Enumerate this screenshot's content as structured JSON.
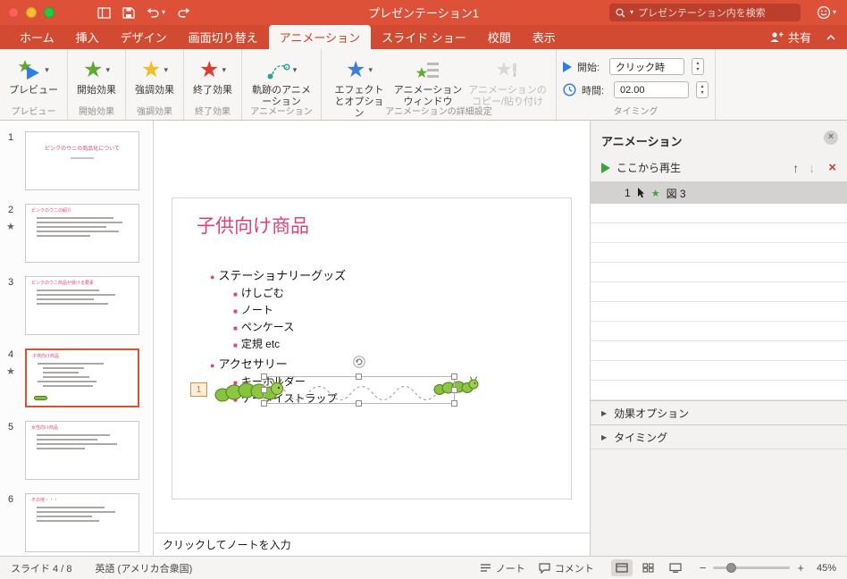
{
  "titlebar": {
    "title": "プレゼンテーション1",
    "search_placeholder": "プレゼンテーション内を検索"
  },
  "tabs": [
    "ホーム",
    "挿入",
    "デザイン",
    "画面切り替え",
    "アニメーション",
    "スライド ショー",
    "校閲",
    "表示"
  ],
  "share_label": "共有",
  "ribbon": {
    "preview_label": "プレビュー",
    "entrance_label": "開始効果",
    "emphasis_label": "強調効果",
    "exit_label": "終了効果",
    "motion_label": "軌跡のアニメーション",
    "effect_options_label": "エフェクトとオプション",
    "anim_window_label": "アニメーションウィンドウ",
    "anim_painter_label": "アニメーションのコピー/貼り付け",
    "group_labels": [
      "プレビュー",
      "開始効果",
      "強調効果",
      "終了効果",
      "アニメーション",
      "アニメーションの詳細設定",
      "タイミング"
    ],
    "timing": {
      "start_label": "開始:",
      "start_value": "クリック時",
      "duration_label": "時間:",
      "duration_value": "02.00"
    }
  },
  "slides": [
    {
      "num": "1",
      "title": "ピンクのウニの商品化について"
    },
    {
      "num": "2",
      "title": "ピンクのウニの紹介"
    },
    {
      "num": "3",
      "title": "ピンクのウニ商品が受ける要素"
    },
    {
      "num": "4",
      "title": "子供向け商品"
    },
    {
      "num": "5",
      "title": "女性向け商品"
    },
    {
      "num": "6",
      "title": "その他・・・"
    }
  ],
  "slide": {
    "title": "子供向け商品",
    "bullet_marker_l1": "●",
    "bullet_marker_l2": "■",
    "bullets": [
      {
        "level": 1,
        "text": "ステーショナリーグッズ"
      },
      {
        "level": 2,
        "text": "けしごむ"
      },
      {
        "level": 2,
        "text": "ノート"
      },
      {
        "level": 2,
        "text": "ペンケース"
      },
      {
        "level": 2,
        "text": "定規 etc"
      },
      {
        "level": 1,
        "text": "アクセサリー"
      },
      {
        "level": 2,
        "text": "キーホルダー"
      },
      {
        "level": 2,
        "text": "ケータイストラップ"
      }
    ],
    "anim_badge": "1",
    "notes_placeholder": "クリックしてノートを入力"
  },
  "anim_pane": {
    "title": "アニメーション",
    "play_from_label": "ここから再生",
    "item_num": "1",
    "item_label": "図 3",
    "section_effect": "効果オプション",
    "section_timing": "タイミング"
  },
  "statusbar": {
    "slide_info": "スライド 4 / 8",
    "language": "英語 (アメリカ合衆国)",
    "notes_label": "ノート",
    "comments_label": "コメント",
    "zoom_value": "45%"
  },
  "icons": {
    "caret_down": "▾",
    "caret_up": "▴",
    "star": "★",
    "arrow_up": "↑",
    "arrow_down": "↓",
    "close_x": "×",
    "delete_x": "×",
    "tri_right": "▶",
    "minus": "−",
    "plus": "+"
  },
  "colors": {
    "titlebar_red": "#DE5139",
    "accent_pink": "#E0417C",
    "selection_orange": "#D6552F"
  }
}
